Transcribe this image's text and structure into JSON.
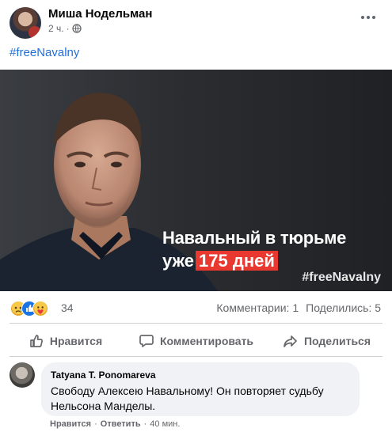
{
  "post": {
    "author": "Миша Нодельман",
    "time": "2 ч.",
    "dot": "·",
    "text": "#freeNavalny",
    "image": {
      "headline_line1": "Навальный в тюрьме",
      "headline_line2_prefix": "уже",
      "headline_highlight": "175 дней",
      "hashtag": "#freeNavalny",
      "highlight_color": "#e8382f"
    },
    "reactions": {
      "icons": [
        "sad-reaction-icon",
        "like-reaction-icon",
        "care-reaction-icon"
      ],
      "count": "34"
    },
    "stats": {
      "comments": "Комментарии: 1",
      "shares": "Поделились: 5"
    },
    "actions": {
      "like": "Нравится",
      "comment": "Комментировать",
      "share": "Поделиться"
    }
  },
  "comment": {
    "author": "Tatyana T. Ponomareva",
    "text": "Свободу Алексею Навальному! Он повторяет судьбу Нельсона Манделы.",
    "like": "Нравится",
    "sep1": "·",
    "reply": "Ответить",
    "sep2": "·",
    "time": "40 мин."
  },
  "colors": {
    "link": "#216fdb",
    "secondary_text": "#65676b",
    "like_blue": "#1b74e4"
  }
}
